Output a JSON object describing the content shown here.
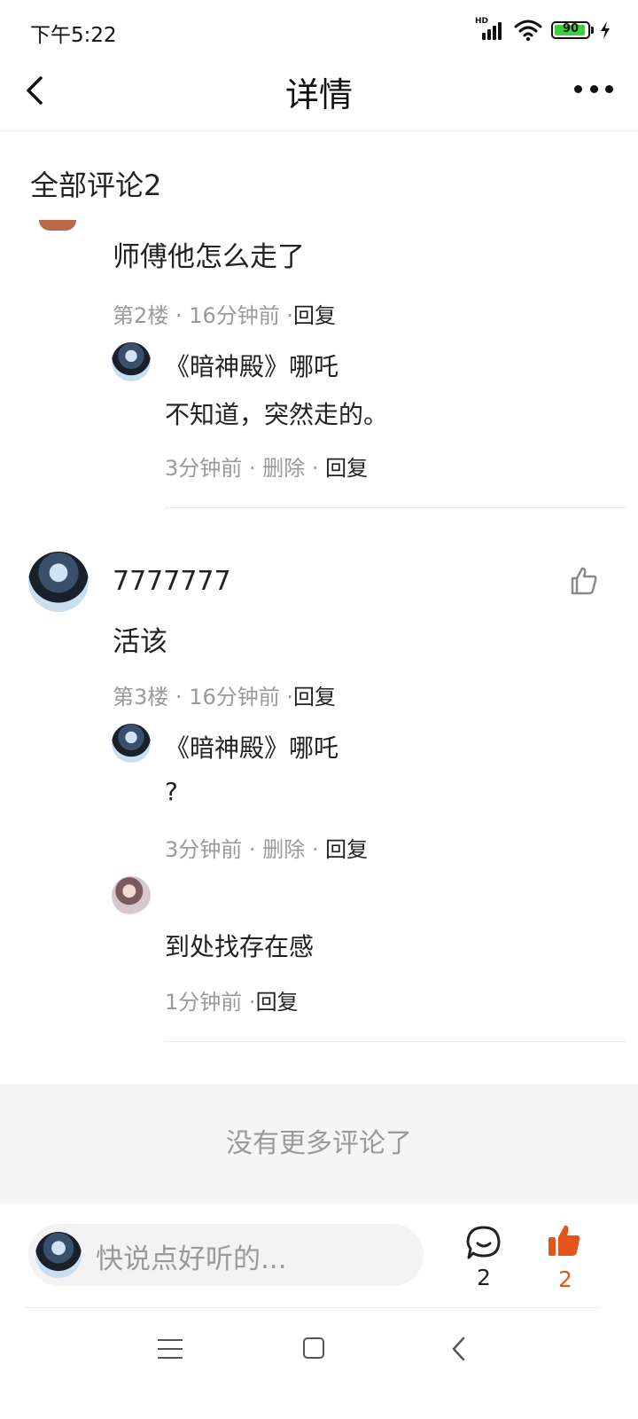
{
  "status_bar": {
    "time": "下午5:22",
    "network_badge": "HD",
    "battery_level": "90"
  },
  "nav": {
    "title": "详情",
    "back_icon": "chevron-left-icon",
    "more_icon": "more-horizontal-icon"
  },
  "section": {
    "title": "全部评论2"
  },
  "comments": [
    {
      "text": "师傅他怎么走了",
      "floor": "第2楼",
      "sep": "·",
      "time": "16分钟前",
      "sep2": "·",
      "reply_label": "回复",
      "replies": [
        {
          "author": "《暗神殿》哪吒",
          "text": "不知道，突然走的。",
          "time": "3分钟前",
          "sep": "·",
          "delete_label": "删除",
          "sep2": "·",
          "reply_label": "回复"
        }
      ]
    },
    {
      "author": "7777777",
      "text": "活该",
      "floor": "第3楼",
      "sep": "·",
      "time": "16分钟前",
      "sep2": "·",
      "reply_label": "回复",
      "replies": [
        {
          "author": "《暗神殿》哪吒",
          "text": "?",
          "time": "3分钟前",
          "sep": "·",
          "delete_label": "删除",
          "sep2": "·",
          "reply_label": "回复"
        },
        {
          "author": "",
          "text": "到处找存在感",
          "time": "1分钟前",
          "sep": "·",
          "reply_label": "回复"
        }
      ]
    }
  ],
  "footer": {
    "no_more": "没有更多评论了"
  },
  "bottom_bar": {
    "placeholder": "快说点好听的...",
    "comment_count": "2",
    "like_count": "2",
    "accent_color": "#e4551c"
  }
}
